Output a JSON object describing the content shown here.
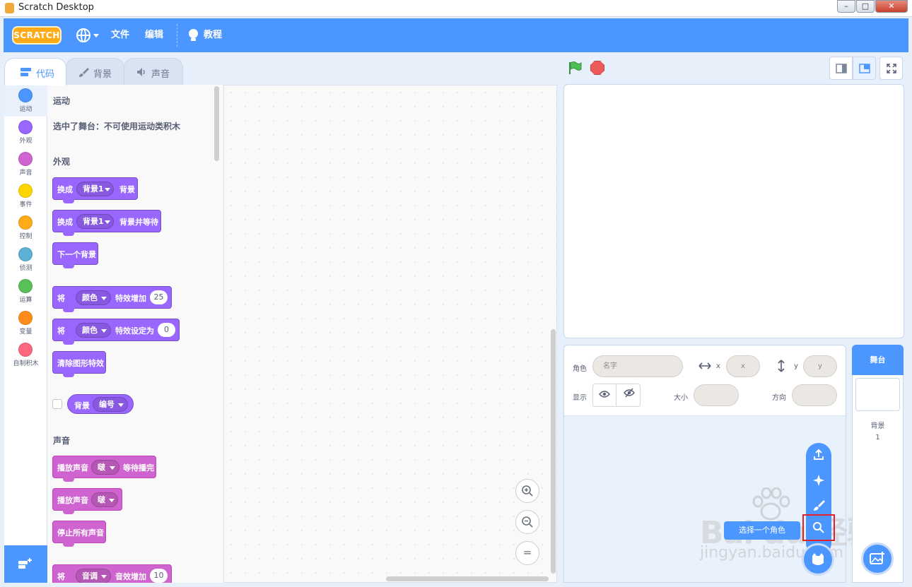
{
  "window": {
    "title": "Scratch Desktop"
  },
  "menubar": {
    "logo": "SCRATCH",
    "file": "文件",
    "edit": "编辑",
    "tutorials": "教程"
  },
  "tabs": [
    {
      "label": "代码",
      "icon": "code-icon",
      "active": true
    },
    {
      "label": "背景",
      "icon": "brush-icon",
      "active": false
    },
    {
      "label": "声音",
      "icon": "speaker-icon",
      "active": false
    }
  ],
  "categories": [
    {
      "label": "运动",
      "color": "#4c97ff"
    },
    {
      "label": "外观",
      "color": "#9966ff"
    },
    {
      "label": "声音",
      "color": "#cf63cf"
    },
    {
      "label": "事件",
      "color": "#ffd500"
    },
    {
      "label": "控制",
      "color": "#ffab19"
    },
    {
      "label": "侦测",
      "color": "#5cb1d6"
    },
    {
      "label": "运算",
      "color": "#59c059"
    },
    {
      "label": "变量",
      "color": "#ff8c1a"
    },
    {
      "label": "自制积木",
      "color": "#ff6680"
    }
  ],
  "palette": {
    "motion_head": "运动",
    "motion_note": "选中了舞台：不可使用运动类积木",
    "looks_head": "外观",
    "looks_blocks": {
      "b1": {
        "t1": "换成",
        "drop": "背景1",
        "t2": "背景"
      },
      "b2": {
        "t1": "换成",
        "drop": "背景1",
        "t2": "背景并等待"
      },
      "b3": {
        "t1": "下一个背景"
      },
      "b4": {
        "t1": "将",
        "drop": "颜色",
        "t2": "特效增加",
        "num": "25"
      },
      "b5": {
        "t1": "将",
        "drop": "颜色",
        "t2": "特效设定为",
        "num": "0"
      },
      "b6": {
        "t1": "清除图形特效"
      },
      "reporter": {
        "t1": "背景",
        "drop": "编号"
      }
    },
    "sound_head": "声音",
    "sound_blocks": {
      "s1": {
        "t1": "播放声音",
        "drop": "啵",
        "t2": "等待播完"
      },
      "s2": {
        "t1": "播放声音",
        "drop": "啵"
      },
      "s3": {
        "t1": "停止所有声音"
      },
      "s4": {
        "t1": "将",
        "drop": "音调",
        "t2": "音效增加",
        "num": "10"
      }
    }
  },
  "zoom": {
    "in": "+",
    "out": "−",
    "reset": "="
  },
  "sprite_info": {
    "sprite_label": "角色",
    "name_placeholder": "名字",
    "x_label": "x",
    "x_placeholder": "x",
    "y_label": "y",
    "y_placeholder": "y",
    "show_label": "显示",
    "size_label": "大小",
    "direction_label": "方向"
  },
  "sprite_menu": {
    "tooltip": "选择一个角色"
  },
  "stage_panel": {
    "header": "舞台",
    "backdrops_label": "背景",
    "backdrops_count": "1"
  },
  "watermark": {
    "main": "Bai du 经验",
    "sub": "jingyan.baidu.com"
  }
}
